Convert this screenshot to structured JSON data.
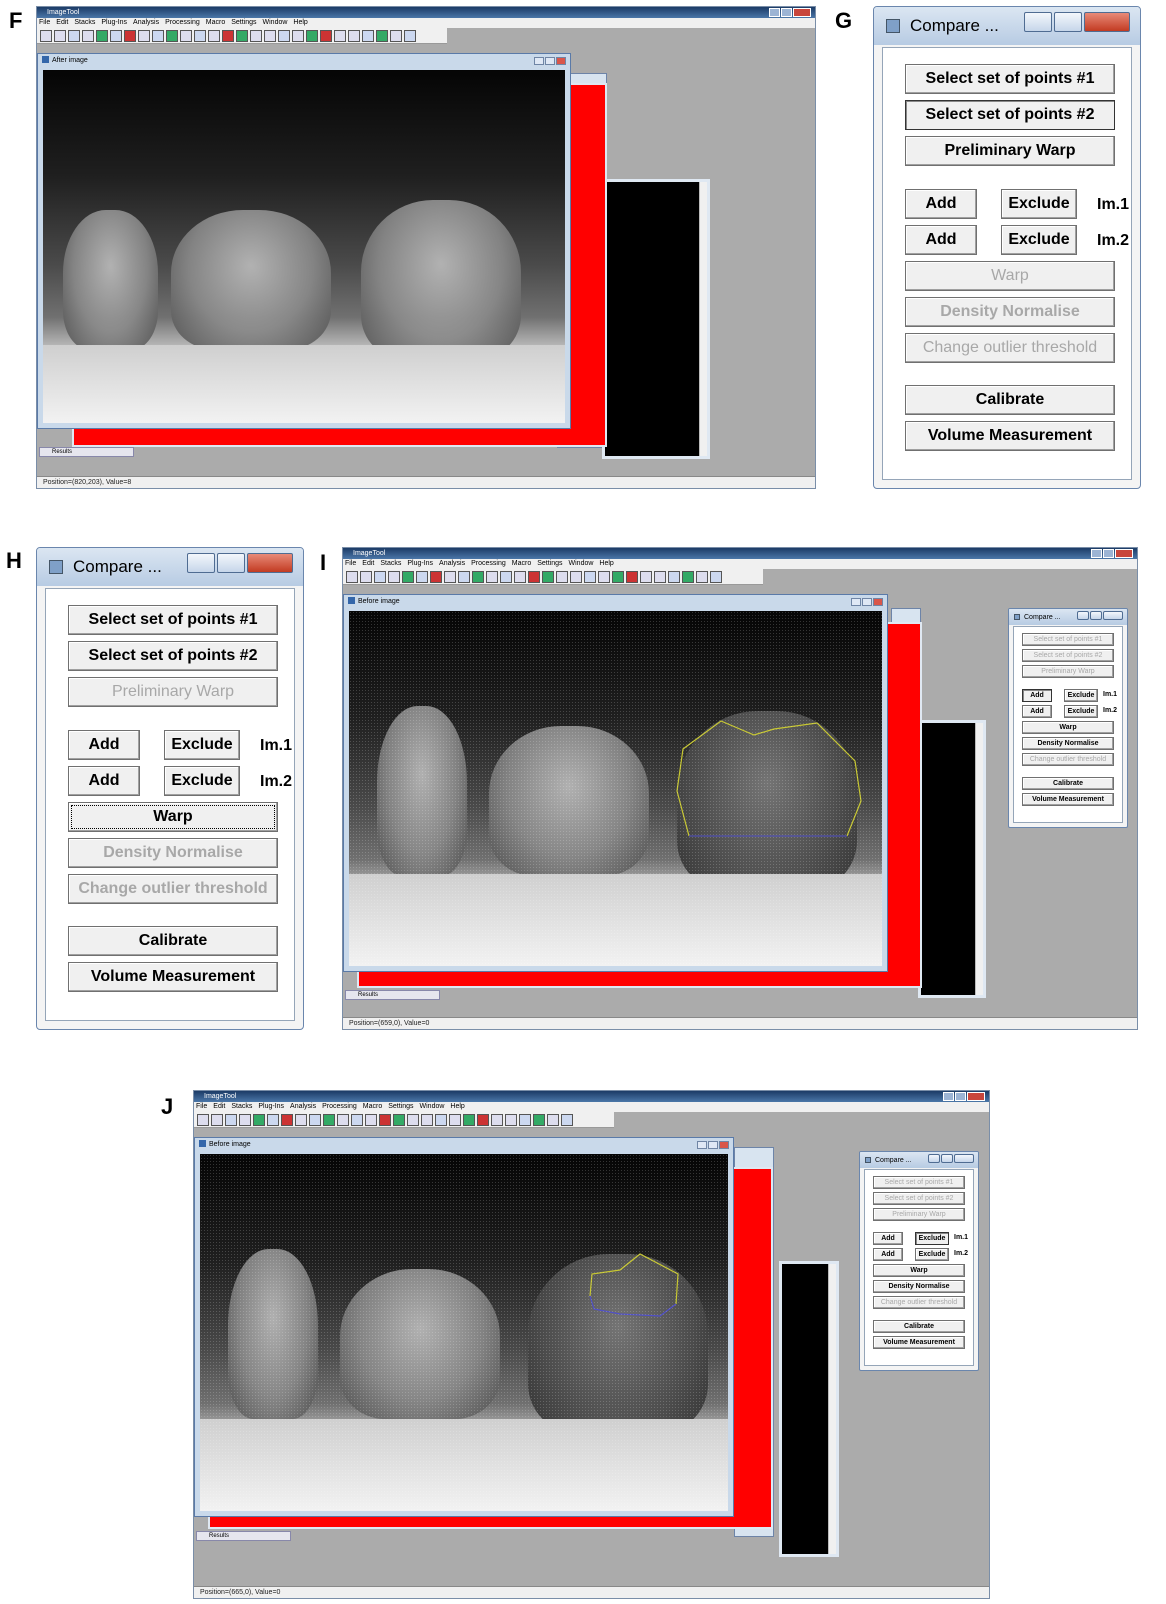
{
  "panel_labels": {
    "f": "F",
    "g": "G",
    "h": "H",
    "i": "I",
    "j": "J"
  },
  "app": {
    "title": "ImageTool",
    "menu": [
      "File",
      "Edit",
      "Stacks",
      "Plug-Ins",
      "Analysis",
      "Processing",
      "Macro",
      "Settings",
      "Window",
      "Help"
    ],
    "results_label": "Results"
  },
  "panel_f": {
    "image_window_title": "After image",
    "status": "Position=(820,203), Value=8"
  },
  "panel_i": {
    "image_window_title": "Before image",
    "status": "Position=(659,0), Value=0"
  },
  "panel_j": {
    "image_window_title": "Before image",
    "status": "Position=(665,0), Value=0"
  },
  "compare_dialog": {
    "title": "Compare ...",
    "buttons": {
      "select1": "Select set of points #1",
      "select2": "Select set of points #2",
      "prelim": "Preliminary Warp",
      "add": "Add",
      "exclude": "Exclude",
      "warp": "Warp",
      "density": "Density Normalise",
      "outlier": "Change outlier threshold",
      "calibrate": "Calibrate",
      "volume": "Volume Measurement"
    },
    "im1": "Im.1",
    "im2": "Im.2"
  },
  "colors": {
    "selection_yellow": "#c8c832",
    "selection_blue": "#5050c8",
    "layer_red": "#ff0000"
  }
}
